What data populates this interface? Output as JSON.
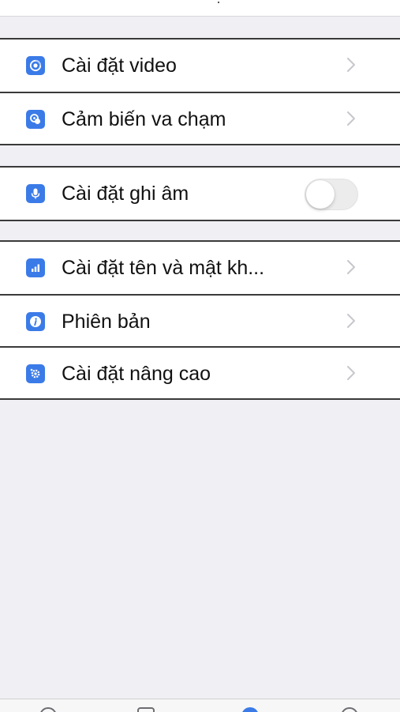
{
  "sections": [
    {
      "items": [
        {
          "label": "Cài đặt video",
          "icon": "video-settings-icon",
          "control": "chevron"
        },
        {
          "label": "Cảm biến va chạm",
          "icon": "collision-sensor-icon",
          "control": "chevron"
        }
      ]
    },
    {
      "items": [
        {
          "label": "Cài đặt ghi âm",
          "icon": "microphone-icon",
          "control": "toggle",
          "toggle_on": false
        }
      ]
    },
    {
      "items": [
        {
          "label": "Cài đặt tên và mật kh...",
          "icon": "wifi-name-password-icon",
          "control": "chevron"
        },
        {
          "label": "Phiên bản",
          "icon": "info-icon",
          "control": "chevron"
        },
        {
          "label": "Cài đặt nâng cao",
          "icon": "advanced-settings-icon",
          "control": "chevron"
        }
      ]
    }
  ],
  "colors": {
    "background": "#efeff4",
    "icon_accent": "#3b7be8",
    "chevron": "#c7c7cc",
    "toggle_off": "#ececec",
    "divider": "#3a3a3a"
  },
  "tab_bar": {
    "icons": [
      "tab-1-icon",
      "tab-2-icon",
      "tab-3-icon",
      "tab-4-icon"
    ],
    "active_index": 2
  }
}
